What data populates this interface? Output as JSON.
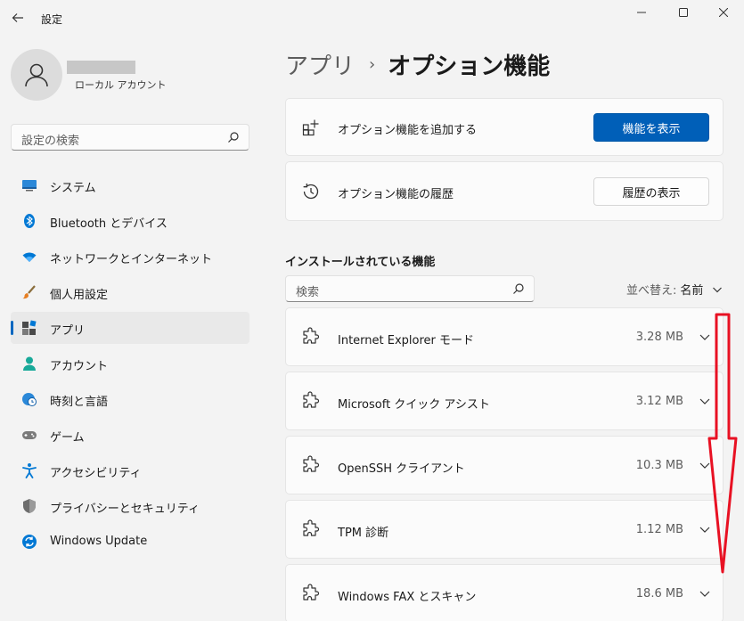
{
  "window": {
    "title": "設定",
    "controls": [
      "minimize-icon",
      "maximize-icon",
      "close-icon"
    ]
  },
  "profile": {
    "account_type": "ローカル アカウント"
  },
  "sidebar": {
    "search_placeholder": "設定の検索",
    "items": [
      {
        "label": "システム",
        "icon": "system-icon"
      },
      {
        "label": "Bluetooth とデバイス",
        "icon": "bluetooth-icon"
      },
      {
        "label": "ネットワークとインターネット",
        "icon": "wifi-icon"
      },
      {
        "label": "個人用設定",
        "icon": "brush-icon"
      },
      {
        "label": "アプリ",
        "icon": "apps-icon",
        "selected": true
      },
      {
        "label": "アカウント",
        "icon": "account-icon"
      },
      {
        "label": "時刻と言語",
        "icon": "globe-clock-icon"
      },
      {
        "label": "ゲーム",
        "icon": "gamepad-icon"
      },
      {
        "label": "アクセシビリティ",
        "icon": "accessibility-icon"
      },
      {
        "label": "プライバシーとセキュリティ",
        "icon": "shield-icon"
      },
      {
        "label": "Windows Update",
        "icon": "update-icon"
      }
    ]
  },
  "breadcrumb": {
    "parent": "アプリ",
    "separator": "›",
    "current": "オプション機能"
  },
  "add_card": {
    "label": "オプション機能を追加する",
    "button": "機能を表示"
  },
  "history_card": {
    "label": "オプション機能の履歴",
    "button": "履歴の表示"
  },
  "installed": {
    "title": "インストールされている機能",
    "search_placeholder": "検索",
    "sort_label": "並べ替え:",
    "sort_value": "名前",
    "features": [
      {
        "name": "Internet Explorer モード",
        "size": "3.28 MB"
      },
      {
        "name": "Microsoft クイック アシスト",
        "size": "3.12 MB"
      },
      {
        "name": "OpenSSH クライアント",
        "size": "10.3 MB"
      },
      {
        "name": "TPM 診断",
        "size": "1.12 MB"
      },
      {
        "name": "Windows FAX とスキャン",
        "size": "18.6 MB"
      }
    ]
  },
  "colors": {
    "accent": "#005fb8",
    "annotation_arrow": "#e81123"
  }
}
